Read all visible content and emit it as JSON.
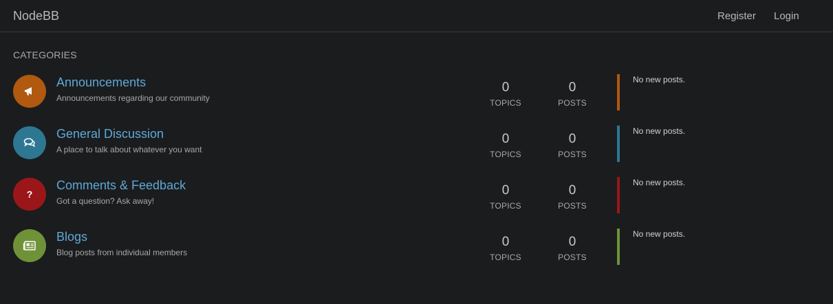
{
  "header": {
    "brand": "NodeBB",
    "register": "Register",
    "login": "Login"
  },
  "section_title": "CATEGORIES",
  "categories": [
    {
      "title": "Announcements",
      "description": "Announcements regarding our community",
      "topics": "0",
      "topics_label": "TOPICS",
      "posts": "0",
      "posts_label": "POSTS",
      "latest": "No new posts.",
      "icon": "bullhorn-icon",
      "color": "#b0590f"
    },
    {
      "title": "General Discussion",
      "description": "A place to talk about whatever you want",
      "topics": "0",
      "topics_label": "TOPICS",
      "posts": "0",
      "posts_label": "POSTS",
      "latest": "No new posts.",
      "icon": "comments-icon",
      "color": "#2d7793"
    },
    {
      "title": "Comments & Feedback",
      "description": "Got a question? Ask away!",
      "topics": "0",
      "topics_label": "TOPICS",
      "posts": "0",
      "posts_label": "POSTS",
      "latest": "No new posts.",
      "icon": "question-icon",
      "color": "#9a1618"
    },
    {
      "title": "Blogs",
      "description": "Blog posts from individual members",
      "topics": "0",
      "topics_label": "TOPICS",
      "posts": "0",
      "posts_label": "POSTS",
      "latest": "No new posts.",
      "icon": "newspaper-icon",
      "color": "#6f9238"
    }
  ]
}
